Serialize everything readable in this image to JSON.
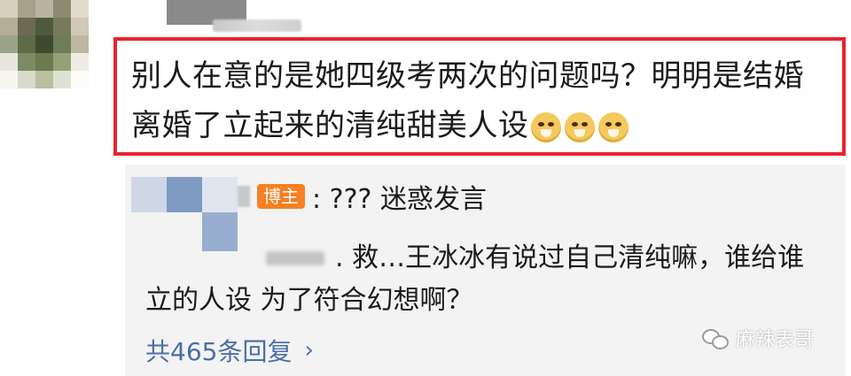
{
  "comment": {
    "text": "别人在意的是她四级考两次的问题吗？明明是结婚离婚了立起来的清纯甜美人设",
    "emojis": [
      "dog-emoji",
      "dog-emoji",
      "dog-emoji"
    ]
  },
  "replies": [
    {
      "badge": "博主",
      "text": ": ??? 迷惑发言"
    },
    {
      "line1": ". 救…王冰冰有说过自己清纯嘛，谁给谁",
      "line2": "立的人设 为了符合幻想啊？"
    }
  ],
  "total_replies": "共465条回复",
  "chevron": "›",
  "watermark": "麻辣表哥",
  "colors": {
    "highlight_border": "#e8242f",
    "link": "#4a6fa8",
    "badge": "#f68023",
    "reply_bg": "#f3f3f3"
  }
}
